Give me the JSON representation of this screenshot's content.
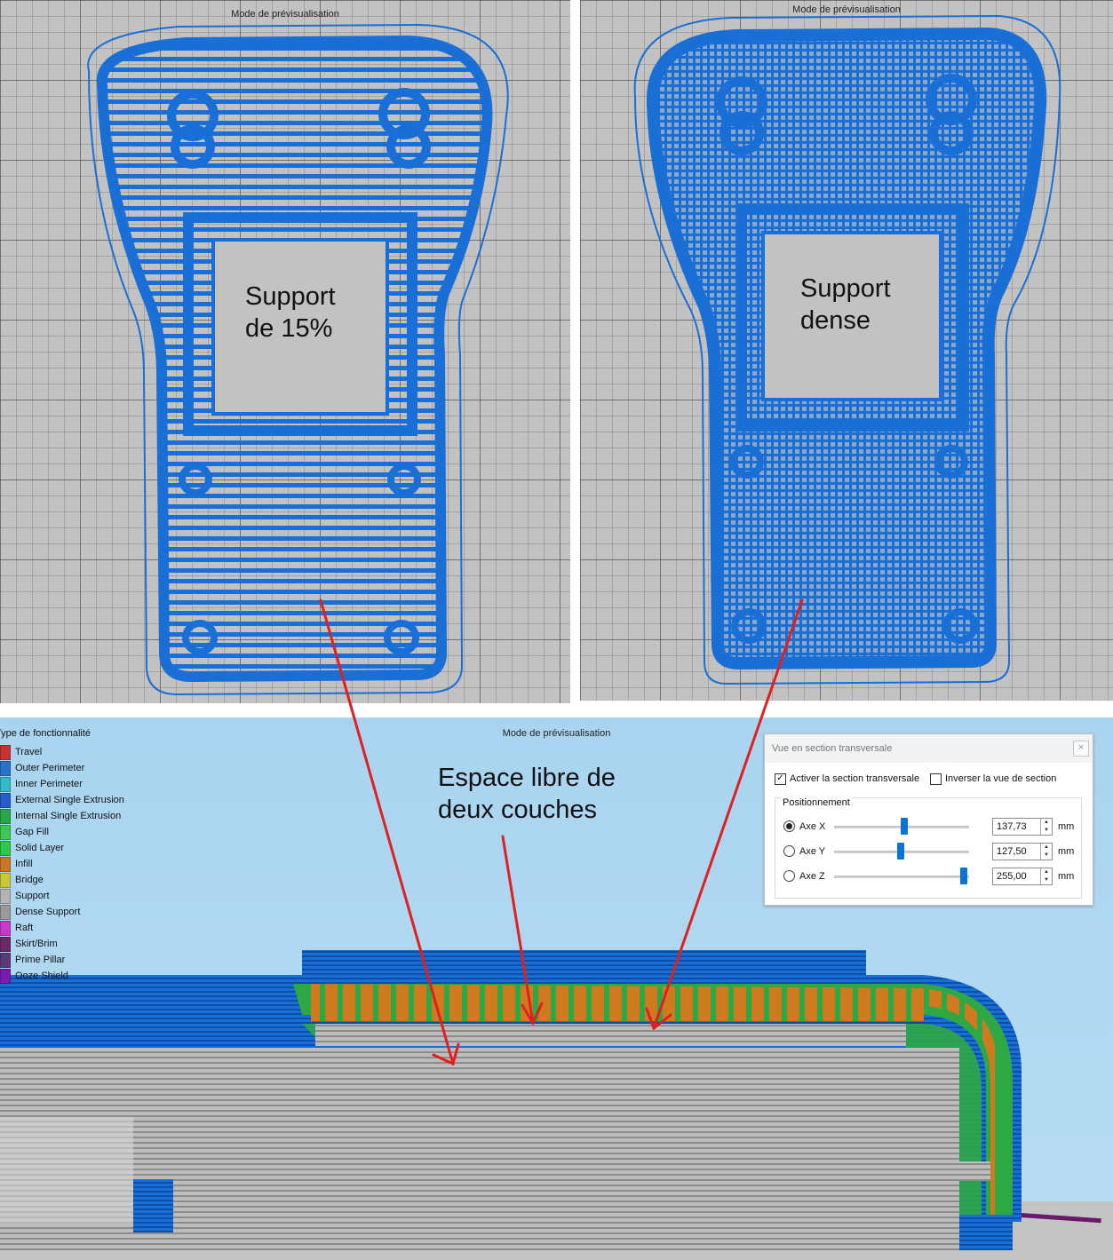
{
  "top_left": {
    "title": "Mode de prévisualisation",
    "label": "Support\nde 15%"
  },
  "top_right": {
    "title": "Mode de prévisualisation",
    "label": "Support\ndense"
  },
  "bottom": {
    "title": "Mode de prévisualisation",
    "annotation": "Espace libre de\ndeux couches",
    "legend": {
      "title": "Type de fonctionnalité",
      "items": [
        {
          "label": "Travel",
          "color": "#c83234"
        },
        {
          "label": "Outer Perimeter",
          "color": "#2a72c8"
        },
        {
          "label": "Inner Perimeter",
          "color": "#35b8c8"
        },
        {
          "label": "External Single Extrusion",
          "color": "#2a5cc8"
        },
        {
          "label": "Internal Single Extrusion",
          "color": "#28a84a"
        },
        {
          "label": "Gap Fill",
          "color": "#3ec85a"
        },
        {
          "label": "Solid Layer",
          "color": "#2fc84a"
        },
        {
          "label": "Infill",
          "color": "#c87820"
        },
        {
          "label": "Bridge",
          "color": "#c8c83a"
        },
        {
          "label": "Support",
          "color": "#b4b4b4"
        },
        {
          "label": "Dense Support",
          "color": "#9a9a9a"
        },
        {
          "label": "Raft",
          "color": "#c83ac8"
        },
        {
          "label": "Skirt/Brim",
          "color": "#6a2a6a"
        },
        {
          "label": "Prime Pillar",
          "color": "#5a3a7a"
        },
        {
          "label": "Ooze Shield",
          "color": "#7a1ab0"
        }
      ]
    }
  },
  "dialog": {
    "title": "Vue en section transversale",
    "close": "×",
    "enable_section": {
      "label": "Activer la section transversale",
      "checked": true
    },
    "invert_view": {
      "label": "Inverser la vue de section",
      "checked": false
    },
    "group_title": "Positionnement",
    "axes": [
      {
        "label": "Axe X",
        "value": "137,73",
        "unit": "mm",
        "selected": true,
        "slider_fraction": 0.52
      },
      {
        "label": "Axe Y",
        "value": "127,50",
        "unit": "mm",
        "selected": false,
        "slider_fraction": 0.5
      },
      {
        "label": "Axe Z",
        "value": "255,00",
        "unit": "mm",
        "selected": false,
        "slider_fraction": 1.0
      }
    ]
  },
  "colors": {
    "part_blue": "#1a6fd6",
    "arrow_red": "#e02020"
  }
}
